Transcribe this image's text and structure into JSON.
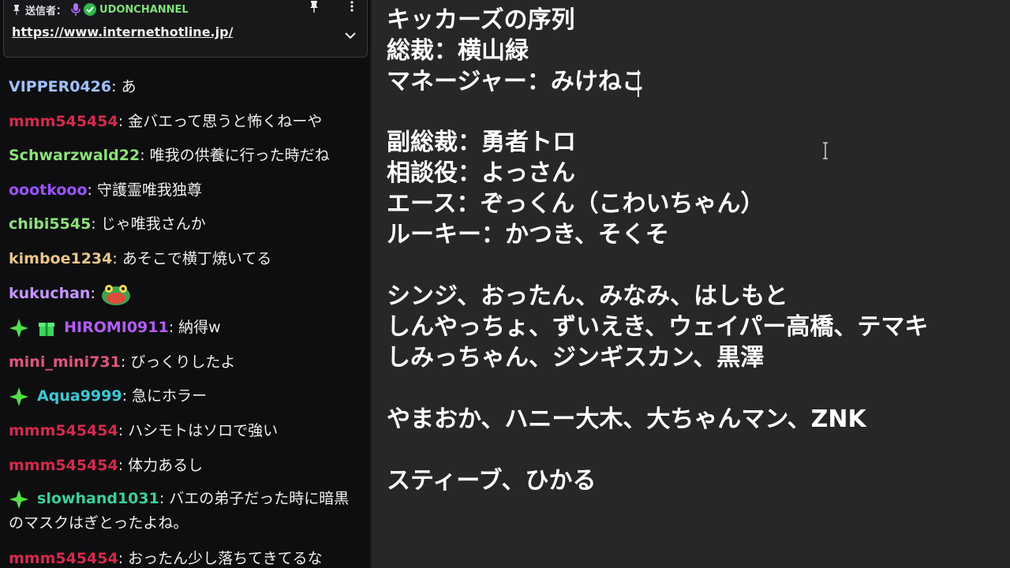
{
  "pinned": {
    "sender_label": "送信者：",
    "sender_name": "UDONCHANNEL",
    "link": "https://www.internethotline.jp/"
  },
  "chat": {
    "messages": [
      {
        "user": "VIPPER0426",
        "color": "#9fc2ff",
        "text": "あ"
      },
      {
        "user": "mmm545454",
        "color": "#d42a4c",
        "text": "金バエって思うと怖くねーや"
      },
      {
        "user": "Schwarzwald22",
        "color": "#8de07b",
        "text": "唯我の供養に行った時だね"
      },
      {
        "user": "oootkooo",
        "color": "#9a52ff",
        "text": "守護霊唯我独尊"
      },
      {
        "user": "chibi5545",
        "color": "#8de07b",
        "text": "じゃ唯我さんか"
      },
      {
        "user": "kimboe1234",
        "color": "#e8c58a",
        "text": "あそこで横丁焼いてる"
      },
      {
        "user": "kukuchan",
        "color": "#c596ff",
        "text": ""
      },
      {
        "user": "HIROMI0911",
        "color": "#b45cff",
        "text": "納得w"
      },
      {
        "user": "mini_mini731",
        "color": "#e0557a",
        "text": "びっくりしたよ"
      },
      {
        "user": "Aqua9999",
        "color": "#3bc9d6",
        "text": "急にホラー"
      },
      {
        "user": "mmm545454",
        "color": "#d42a4c",
        "text": "ハシモトはソロで強い"
      },
      {
        "user": "mmm545454",
        "color": "#d42a4c",
        "text": "体力あるし"
      },
      {
        "user": "slowhand1031",
        "color": "#3bcf9e",
        "text": "バエの弟子だった時に暗黒のマスクはぎとったよね。"
      },
      {
        "user": "mmm545454",
        "color": "#d42a4c",
        "text": "おったん少し落ちてきてるな"
      }
    ]
  },
  "notepad": {
    "lines": [
      "キッカーズの序列",
      "総裁：横山緑",
      "マネージャー：みけねこ",
      "副総裁：勇者トロ",
      "相談役：よっさん",
      "エース：ぞっくん（こわいちゃん）",
      "ルーキー：かつき、そくそ",
      "シンジ、おったん、みなみ、はしもと",
      "しんやっちょ、ずいえき、ウェイパー高橋、テマキ",
      "しみっちゃん、ジンギスカン、黒澤",
      "やまおか、ハニー大木、大ちゃんマン、ZNK",
      "スティーブ、ひかる"
    ]
  },
  "icons": {
    "pin": "pin-icon",
    "mic": "microphone-icon",
    "verified": "verified-badge-icon",
    "more": "more-vertical-icon",
    "chevron": "chevron-down-icon",
    "prime": "prime-sparkle-icon",
    "gift": "sub-gift-icon",
    "emote": "frog-emote-icon",
    "cursor": "text-cursor-icon"
  }
}
